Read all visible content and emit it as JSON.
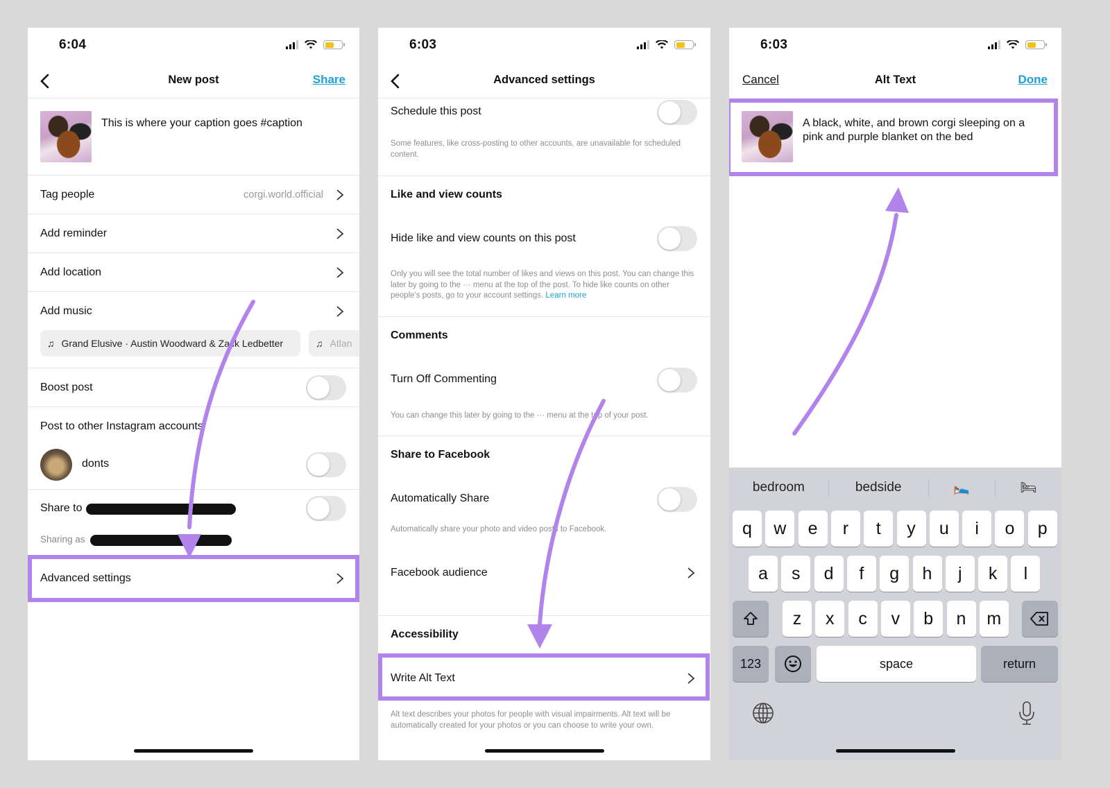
{
  "colors": {
    "accent_link": "#1fa0d8",
    "highlight": "#b383ec",
    "background": "#d9d9d9",
    "keyboard_bg": "#d1d3d9",
    "battery": "#f2c21a"
  },
  "screens": [
    {
      "status_time": "6:04",
      "nav": {
        "title": "New post",
        "back_icon": "chevron-left-icon",
        "right_action": "Share"
      },
      "caption": "This is where your caption goes #caption",
      "rows": {
        "tag_people": {
          "label": "Tag people",
          "value": "corgi.world.official"
        },
        "add_reminder": {
          "label": "Add reminder"
        },
        "add_location": {
          "label": "Add location"
        },
        "add_music": {
          "label": "Add music"
        }
      },
      "music_chips": [
        {
          "icon": "music-note-icon",
          "label": "Grand Elusive · Austin Woodward & Zack Ledbetter"
        },
        {
          "icon": "music-note-icon",
          "label": "Atlan"
        }
      ],
      "boost_post": {
        "label": "Boost post",
        "on": false
      },
      "other_accounts": {
        "label": "Post to other Instagram accounts",
        "account": "donts",
        "on": false
      },
      "share_to": {
        "label": "Share to",
        "on": false,
        "sharing_as_label": "Sharing as"
      },
      "advanced_settings": {
        "label": "Advanced settings",
        "highlighted": true
      }
    },
    {
      "status_time": "6:03",
      "nav": {
        "title": "Advanced settings",
        "back_icon": "chevron-left-icon"
      },
      "schedule": {
        "label": "Schedule this post",
        "on": false,
        "note": "Some features, like cross-posting to other accounts, are unavailable for scheduled content."
      },
      "like_counts": {
        "title": "Like and view counts",
        "label": "Hide like and view counts on this post",
        "on": false,
        "note": "Only you will see the total number of likes and views on this post. You can change this later by going to the ··· menu at the top of the post. To hide like counts on other people's posts, go to your account settings.",
        "learn_more": "Learn more"
      },
      "comments": {
        "title": "Comments",
        "label": "Turn Off Commenting",
        "on": false,
        "note": "You can change this later by going to the ··· menu at the top of your post."
      },
      "facebook": {
        "title": "Share to Facebook",
        "label": "Automatically Share",
        "on": false,
        "note": "Automatically share your photo and video posts to Facebook.",
        "audience": "Facebook audience"
      },
      "accessibility": {
        "title": "Accessibility",
        "write_alt": "Write Alt Text",
        "highlighted": true,
        "note": "Alt text describes your photos for people with visual impairments. Alt text will be automatically created for your photos or you can choose to write your own."
      }
    },
    {
      "status_time": "6:03",
      "nav": {
        "title": "Alt Text",
        "left_action": "Cancel",
        "right_action": "Done"
      },
      "alt_text_value": "A black, white, and brown corgi sleeping on a pink and purple blanket on the bed",
      "keyboard": {
        "suggestions": [
          "bedroom",
          "bedside",
          "🛌",
          "🛏"
        ],
        "row1": [
          "q",
          "w",
          "e",
          "r",
          "t",
          "y",
          "u",
          "i",
          "o",
          "p"
        ],
        "row2": [
          "a",
          "s",
          "d",
          "f",
          "g",
          "h",
          "j",
          "k",
          "l"
        ],
        "row3": [
          "z",
          "x",
          "c",
          "v",
          "b",
          "n",
          "m"
        ],
        "shift_icon": "shift-arrow-icon",
        "delete_icon": "backspace-icon",
        "numbers_label": "123",
        "emoji_icon": "emoji-smile-icon",
        "space_label": "space",
        "return_label": "return",
        "globe_icon": "globe-icon",
        "mic_icon": "microphone-icon"
      }
    }
  ]
}
